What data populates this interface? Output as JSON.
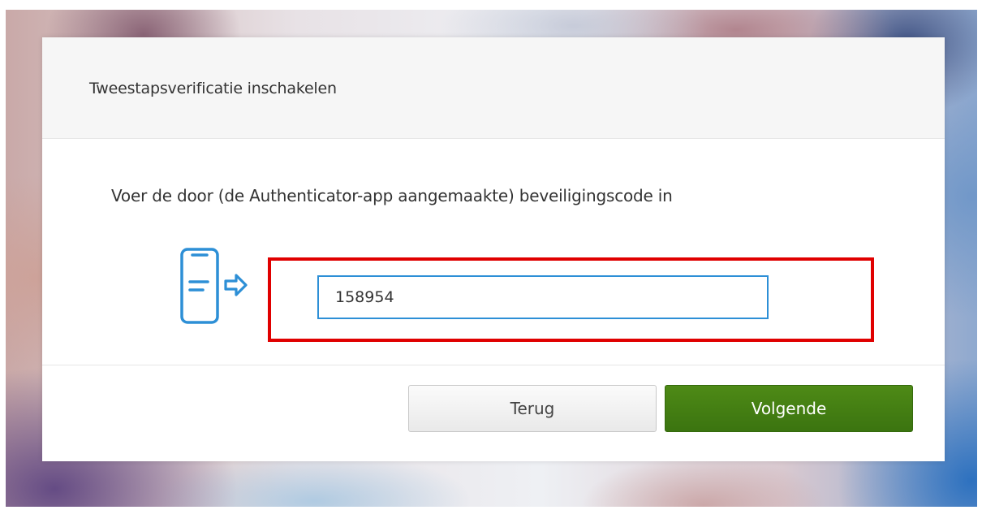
{
  "dialog": {
    "title": "Tweestapsverificatie inschakelen",
    "instruction": "Voer de door (de Authenticator-app aangemaakte) beveiligingscode in",
    "code_field": {
      "value": "158954",
      "placeholder": ""
    },
    "buttons": {
      "back_label": "Terug",
      "next_label": "Volgende"
    }
  },
  "icons": {
    "device": "phone-to-arrow-icon"
  },
  "colors": {
    "accent_blue": "#2d8fd6",
    "primary_green": "#3f7a12",
    "highlight_red": "#e00000",
    "text": "#333333"
  }
}
